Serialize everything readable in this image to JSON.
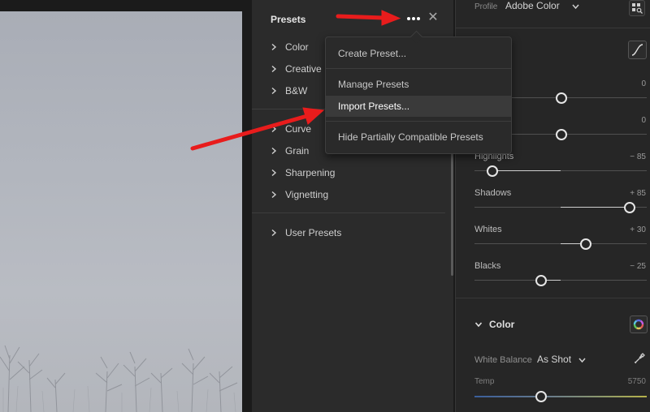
{
  "presets_panel": {
    "title": "Presets",
    "groups": [
      {
        "label": "Color"
      },
      {
        "label": "Creative"
      },
      {
        "label": "B&W"
      },
      {
        "label": "Curve"
      },
      {
        "label": "Grain"
      },
      {
        "label": "Sharpening"
      },
      {
        "label": "Vignetting"
      },
      {
        "label": "User Presets"
      }
    ],
    "more_icon": "ellipsis-icon",
    "close_icon": "close-icon"
  },
  "menu": {
    "items": [
      {
        "label": "Create Preset..."
      },
      {
        "label": "Manage Presets"
      },
      {
        "label": "Import Presets..."
      },
      {
        "label": "Hide Partially Compatible Presets"
      }
    ],
    "highlighted": "Import Presets..."
  },
  "edit_panel": {
    "profile": {
      "label": "Profile",
      "value": "Adobe Color"
    },
    "sliders": [
      {
        "label": "",
        "value": "0",
        "level": 0
      },
      {
        "label": "",
        "value": "0",
        "level": 0
      },
      {
        "label": "Highlights",
        "value": "− 85",
        "level": -85
      },
      {
        "label": "Shadows",
        "value": "+ 85",
        "level": 85
      },
      {
        "label": "Whites",
        "value": "+ 30",
        "level": 30
      },
      {
        "label": "Blacks",
        "value": "− 25",
        "level": -25
      }
    ],
    "color_section": {
      "title": "Color",
      "white_balance_label": "White Balance",
      "white_balance_value": "As Shot",
      "temp_label": "Temp",
      "temp_value": "5750",
      "temp_level": 0.39
    }
  },
  "colors": {
    "annotation_arrow": "#e81c1c",
    "panel_bg": "#2b2b2b",
    "menu_highlight": "#3a3a3a"
  }
}
